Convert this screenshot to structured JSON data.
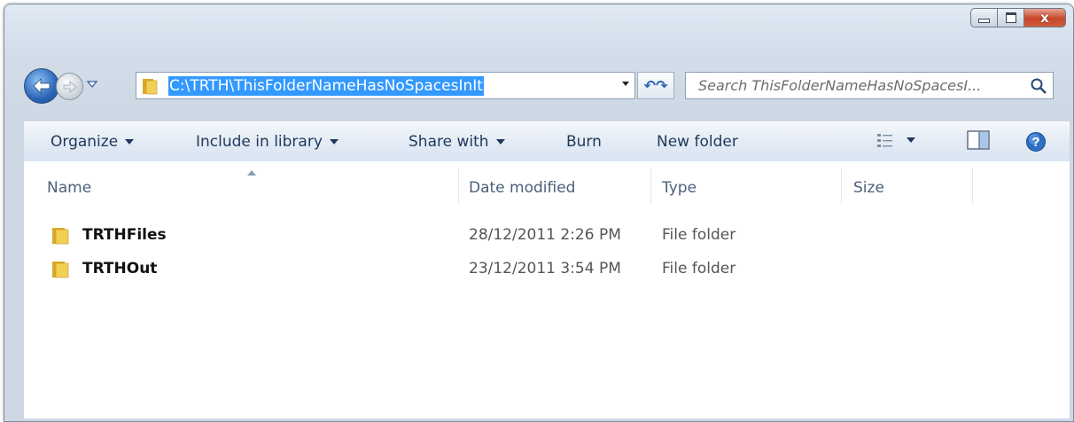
{
  "window": {
    "controls": {
      "minimize_icon": "minimize-icon",
      "maximize_icon": "maximize-icon",
      "close_glyph": "x"
    }
  },
  "nav": {
    "back_icon": "back-arrow-icon",
    "forward_icon": "forward-arrow-icon",
    "address_path": "C:\\TRTH\\ThisFolderNameHasNoSpacesInIt",
    "search_placeholder": "Search ThisFolderNameHasNoSpacesI...",
    "refresh_glyph": "↶↷"
  },
  "toolbar": {
    "organize_label": "Organize",
    "include_label": "Include in library",
    "share_label": "Share with",
    "burn_label": "Burn",
    "new_folder_label": "New folder",
    "help_glyph": "?"
  },
  "columns": {
    "name": "Name",
    "date_modified": "Date modified",
    "type": "Type",
    "size": "Size"
  },
  "files": [
    {
      "name": "TRTHFiles",
      "date": "28/12/2011 2:26 PM",
      "type": "File folder"
    },
    {
      "name": "TRTHOut",
      "date": "23/12/2011 3:54 PM",
      "type": "File folder"
    }
  ],
  "colors": {
    "selection": "#3399ff",
    "folder_yellow": "#e8c14a",
    "close_red": "#c7462b"
  }
}
